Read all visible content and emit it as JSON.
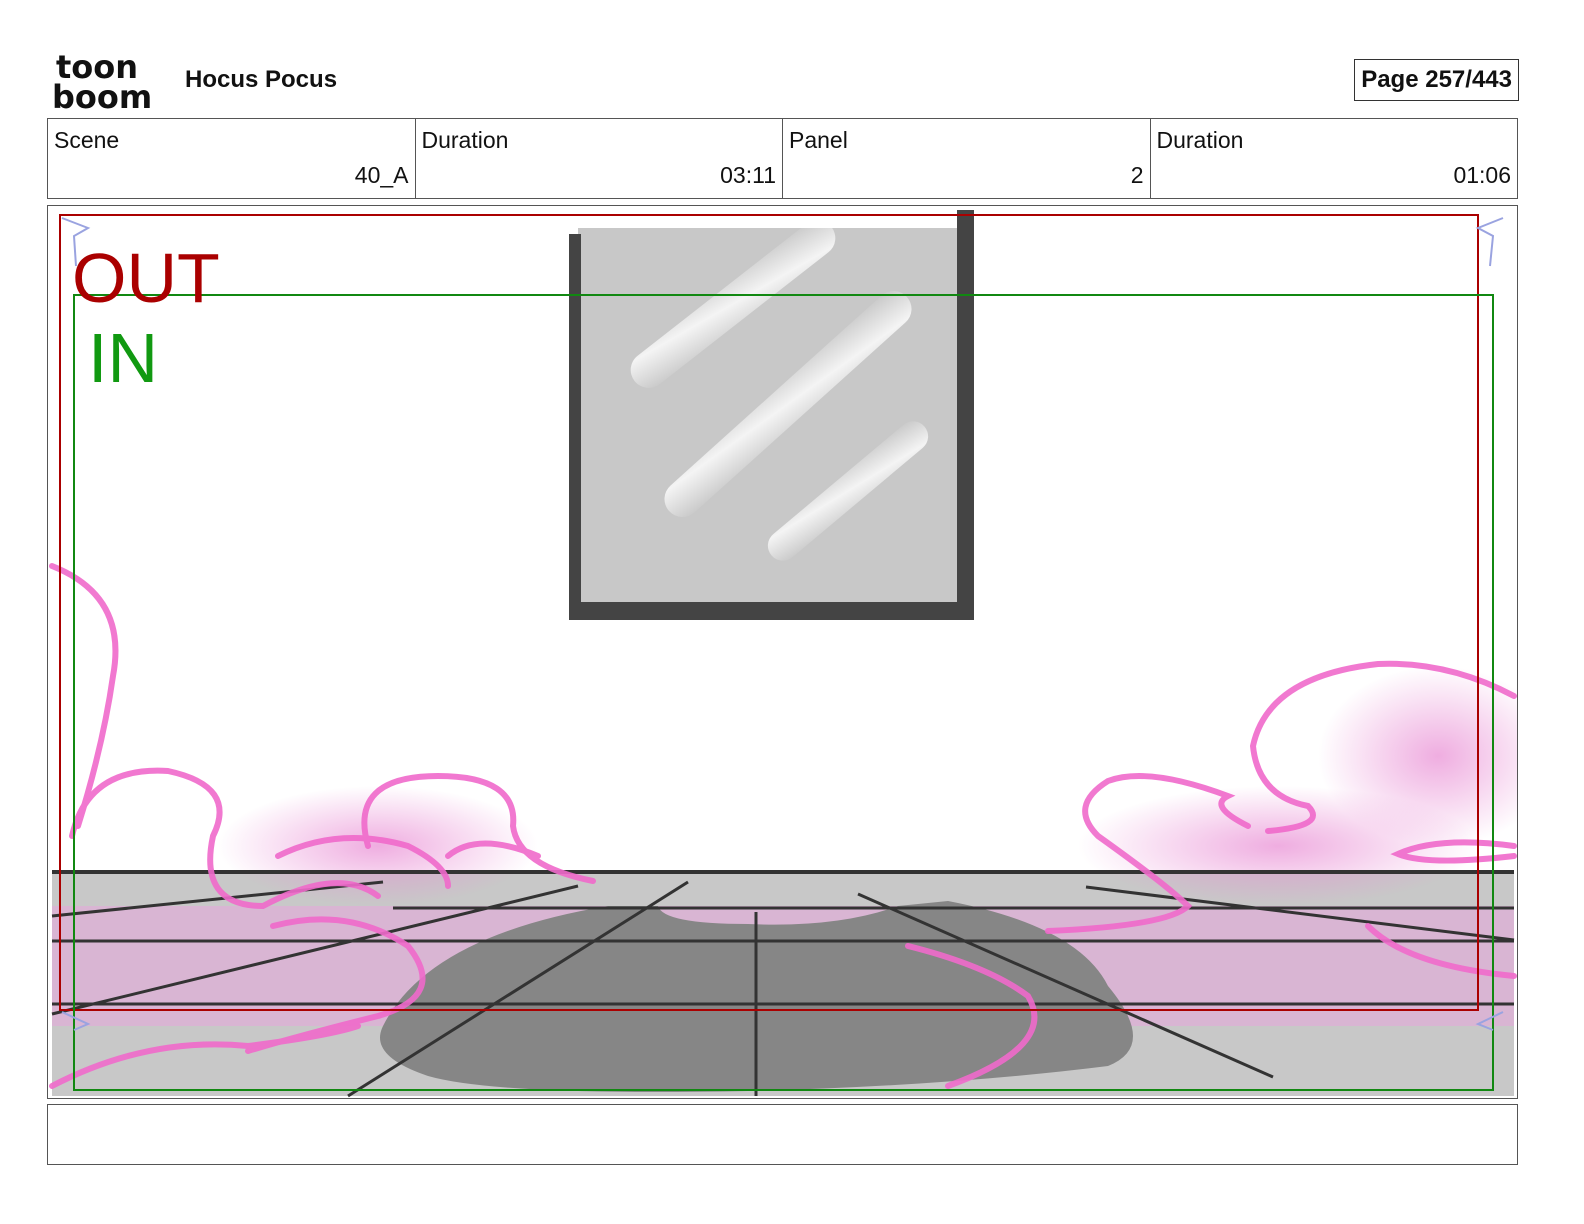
{
  "header": {
    "logo_text_top": "toon",
    "logo_text_bottom": "boom",
    "project_title": "Hocus Pocus",
    "page_indicator": "Page 257/443"
  },
  "info": {
    "scene_label": "Scene",
    "scene_value": "40_A",
    "scene_duration_label": "Duration",
    "scene_duration_value": "03:11",
    "panel_label": "Panel",
    "panel_value": "2",
    "panel_duration_label": "Duration",
    "panel_duration_value": "01:06"
  },
  "panel": {
    "out_label": "OUT",
    "in_label": "IN",
    "colors": {
      "out_frame": "#aa0000",
      "in_frame": "#118811",
      "smoke": "#f06acb",
      "floor": "#c8c8c8",
      "shadow": "#868686",
      "window_glass": "#c8c8c8",
      "window_frame": "#444444"
    }
  },
  "notes": {
    "text": ""
  }
}
